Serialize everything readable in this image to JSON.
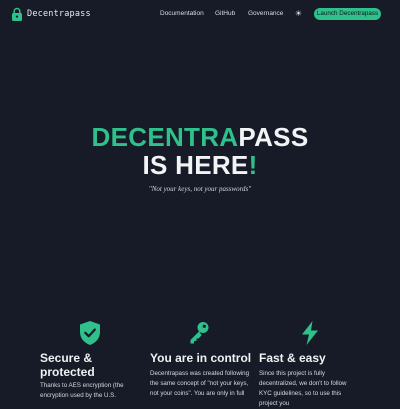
{
  "brand": {
    "name": "Decentrapass",
    "accent": "#2fc08c",
    "background": "#161b27",
    "logo_icon": "lock-icon"
  },
  "nav": {
    "links": [
      "Documentation",
      "GitHub",
      "Governance"
    ],
    "theme_toggle_icon": "sun-icon",
    "theme_toggle_glyph": "☀",
    "launch_label": "Launch Decentrapass"
  },
  "hero": {
    "line1_accent": "DECENTRA",
    "line1_rest": "PASS",
    "line2_text": "IS HERE",
    "line2_accent": "!",
    "tagline": "\"Not your keys, not your passwords\""
  },
  "features": [
    {
      "icon": "shield-check-icon",
      "title": "Secure & protected",
      "text": "Thanks to AES encryption (the encryption used by the U.S."
    },
    {
      "icon": "key-icon",
      "title": "You are in control",
      "text": "Decentrapass was created following the same concept of \"not your keys, not your coins\". You are only in full"
    },
    {
      "icon": "bolt-icon",
      "title": "Fast & easy",
      "text": "Since this project is fully decentralized, we don't to follow KYC guidelines, so to use this project you"
    }
  ]
}
